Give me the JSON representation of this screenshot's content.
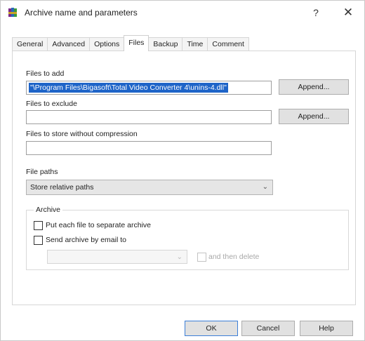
{
  "window": {
    "title": "Archive name and parameters",
    "help_glyph": "?",
    "close_glyph": "✕"
  },
  "tabs": [
    {
      "label": "General",
      "active": false
    },
    {
      "label": "Advanced",
      "active": false
    },
    {
      "label": "Options",
      "active": false
    },
    {
      "label": "Files",
      "active": true
    },
    {
      "label": "Backup",
      "active": false
    },
    {
      "label": "Time",
      "active": false
    },
    {
      "label": "Comment",
      "active": false
    }
  ],
  "files_to_add": {
    "label": "Files to add",
    "value": "\"\\Program Files\\Bigasoft\\Total Video Converter 4\\unins-4.dll\"",
    "append_label": "Append..."
  },
  "files_to_exclude": {
    "label": "Files to exclude",
    "value": "",
    "append_label": "Append..."
  },
  "files_no_compression": {
    "label": "Files to store without compression",
    "value": ""
  },
  "file_paths": {
    "label": "File paths",
    "selected": "Store relative paths"
  },
  "archive_group": {
    "title": "Archive",
    "separate_archive_label": "Put each file to separate archive",
    "separate_archive_checked": false,
    "send_email_label": "Send archive by email to",
    "send_email_checked": false,
    "email_value": "",
    "then_delete_label": "and then delete",
    "then_delete_checked": false
  },
  "buttons": {
    "ok": "OK",
    "cancel": "Cancel",
    "help": "Help"
  },
  "icons": {
    "app": "winrar-books-icon",
    "dropdown": "chevron-down-icon"
  }
}
